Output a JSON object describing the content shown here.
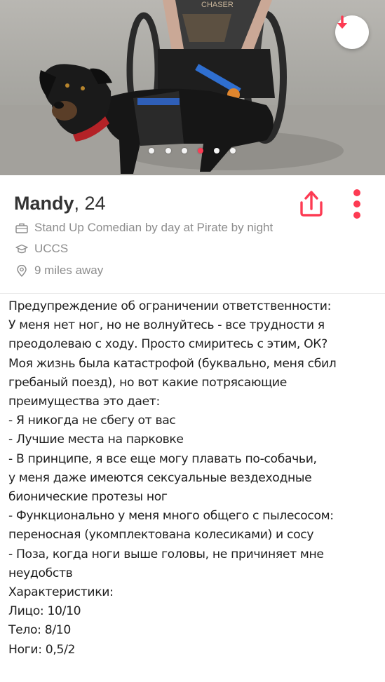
{
  "photo": {
    "shirt_text": "CHASER",
    "carousel_count": 6,
    "carousel_active_index": 3
  },
  "profile": {
    "name": "Mandy",
    "age": "24",
    "job": "Stand Up Comedian by day at Pirate by night",
    "school": "UCCS",
    "distance": "9 miles away"
  },
  "icons": {
    "down": "arrow-down-icon",
    "share": "share-icon",
    "more": "more-vertical-icon",
    "job": "briefcase-icon",
    "school": "graduation-cap-icon",
    "distance": "location-pin-icon"
  },
  "colors": {
    "accent": "#fd3b53",
    "text": "#333333",
    "muted": "#8d8d8d"
  },
  "bio_lines": [
    "Предупреждение об ограничении ответственности:",
    "У меня нет ног, но не волнуйтесь - все трудности я",
    "преодолеваю с ходу. Просто смиритесь с этим, ОК?",
    "Моя жизнь была катастрофой (буквально, меня сбил",
    "гребаный поезд), но вот какие потрясающие",
    "преимущества это дает:",
    "- Я никогда не сбегу от вас",
    "- Лучшие места на парковке",
    "- В принципе, я все еще могу плавать по-собачьи,",
    "у меня даже имеются сексуальные вездеходные",
    "бионические протезы ног",
    "- Функционально у меня много общего с пылесосом:",
    "переносная (укомплектована колесиками) и сосу",
    "- Поза, когда ноги выше головы, не причиняет мне",
    "неудобств",
    "Характеристики:",
    "Лицо: 10/10",
    "Тело: 8/10",
    "Ноги: 0,5/2"
  ]
}
